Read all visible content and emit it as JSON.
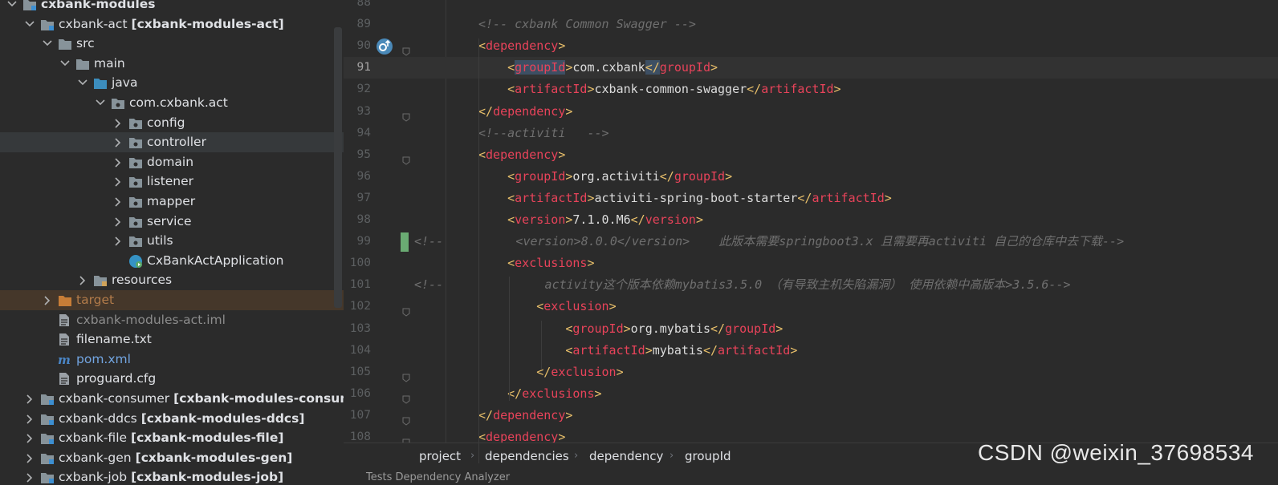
{
  "project_tree": {
    "root": {
      "label": "cxbank-modules"
    },
    "act_module": {
      "label": "cxbank-act",
      "module": "[cxbank-modules-act]"
    },
    "src": {
      "label": "src"
    },
    "main": {
      "label": "main"
    },
    "java": {
      "label": "java"
    },
    "package": {
      "label": "com.cxbank.act"
    },
    "packages": [
      "config",
      "controller",
      "domain",
      "listener",
      "mapper",
      "service",
      "utils"
    ],
    "app_class": {
      "label": "CxBankActApplication"
    },
    "resources": {
      "label": "resources"
    },
    "target": {
      "label": "target"
    },
    "files": [
      "cxbank-modules-act.iml",
      "filename.txt",
      "pom.xml",
      "proguard.cfg"
    ],
    "modules": [
      {
        "label": "cxbank-consumer",
        "module": "[cxbank-modules-consume"
      },
      {
        "label": "cxbank-ddcs",
        "module": "[cxbank-modules-ddcs]"
      },
      {
        "label": "cxbank-file",
        "module": "[cxbank-modules-file]"
      },
      {
        "label": "cxbank-gen",
        "module": "[cxbank-modules-gen]"
      },
      {
        "label": "cxbank-job",
        "module": "[cxbank-modules-job]"
      }
    ]
  },
  "editor": {
    "lines": [
      {
        "n": "88",
        "parts": []
      },
      {
        "n": "89",
        "parts": [
          {
            "t": "<!-- cxbank Common Swagger -->",
            "c": "cmt"
          }
        ]
      },
      {
        "n": "90",
        "parts": [
          {
            "t": "<",
            "c": "tag"
          },
          {
            "t": "dependency",
            "c": "tname"
          },
          {
            "t": ">",
            "c": "tag"
          }
        ]
      },
      {
        "n": "91",
        "parts": [
          {
            "t": "    <",
            "c": "tag"
          },
          {
            "t": "groupId",
            "c": "tname"
          },
          {
            "t": ">",
            "c": "tag"
          },
          {
            "t": "com.cxbank",
            "c": "text"
          },
          {
            "t": "</",
            "c": "tag"
          },
          {
            "t": "groupId",
            "c": "tname"
          },
          {
            "t": ">",
            "c": "tag"
          }
        ]
      },
      {
        "n": "92",
        "parts": [
          {
            "t": "    <",
            "c": "tag"
          },
          {
            "t": "artifactId",
            "c": "tname"
          },
          {
            "t": ">",
            "c": "tag"
          },
          {
            "t": "cxbank-common-swagger",
            "c": "text"
          },
          {
            "t": "</",
            "c": "tag"
          },
          {
            "t": "artifactId",
            "c": "tname"
          },
          {
            "t": ">",
            "c": "tag"
          }
        ]
      },
      {
        "n": "93",
        "parts": [
          {
            "t": "</",
            "c": "tag"
          },
          {
            "t": "dependency",
            "c": "tname"
          },
          {
            "t": ">",
            "c": "tag"
          }
        ]
      },
      {
        "n": "94",
        "parts": [
          {
            "t": "<!--activiti   -->",
            "c": "cmt"
          }
        ]
      },
      {
        "n": "95",
        "parts": [
          {
            "t": "<",
            "c": "tag"
          },
          {
            "t": "dependency",
            "c": "tname"
          },
          {
            "t": ">",
            "c": "tag"
          }
        ]
      },
      {
        "n": "96",
        "parts": [
          {
            "t": "    <",
            "c": "tag"
          },
          {
            "t": "groupId",
            "c": "tname"
          },
          {
            "t": ">",
            "c": "tag"
          },
          {
            "t": "org.activiti",
            "c": "text"
          },
          {
            "t": "</",
            "c": "tag"
          },
          {
            "t": "groupId",
            "c": "tname"
          },
          {
            "t": ">",
            "c": "tag"
          }
        ]
      },
      {
        "n": "97",
        "parts": [
          {
            "t": "    <",
            "c": "tag"
          },
          {
            "t": "artifactId",
            "c": "tname"
          },
          {
            "t": ">",
            "c": "tag"
          },
          {
            "t": "activiti-spring-boot-starter",
            "c": "text"
          },
          {
            "t": "</",
            "c": "tag"
          },
          {
            "t": "artifactId",
            "c": "tname"
          },
          {
            "t": ">",
            "c": "tag"
          }
        ]
      },
      {
        "n": "98",
        "parts": [
          {
            "t": "    <",
            "c": "tag"
          },
          {
            "t": "version",
            "c": "tname"
          },
          {
            "t": ">",
            "c": "tag"
          },
          {
            "t": "7.1.0.M6",
            "c": "text"
          },
          {
            "t": "</",
            "c": "tag"
          },
          {
            "t": "version",
            "c": "tname"
          },
          {
            "t": ">",
            "c": "tag"
          }
        ]
      },
      {
        "n": "99",
        "parts": [
          {
            "t": "<!--          <version>8.0.0</version>    此版本需要springboot3.x 且需要再activiti 自己的仓库中去下载-->",
            "c": "cmt"
          }
        ]
      },
      {
        "n": "100",
        "parts": [
          {
            "t": "    <",
            "c": "tag"
          },
          {
            "t": "exclusions",
            "c": "tname"
          },
          {
            "t": ">",
            "c": "tag"
          }
        ]
      },
      {
        "n": "101",
        "parts": [
          {
            "t": "<!--              activity这个版本依赖mybatis3.5.0 （有导致主机失陷漏洞） 使用依赖中高版本>3.5.6-->",
            "c": "cmt"
          }
        ]
      },
      {
        "n": "102",
        "parts": [
          {
            "t": "        <",
            "c": "tag"
          },
          {
            "t": "exclusion",
            "c": "tname"
          },
          {
            "t": ">",
            "c": "tag"
          }
        ]
      },
      {
        "n": "103",
        "parts": [
          {
            "t": "            <",
            "c": "tag"
          },
          {
            "t": "groupId",
            "c": "tname"
          },
          {
            "t": ">",
            "c": "tag"
          },
          {
            "t": "org.mybatis",
            "c": "text"
          },
          {
            "t": "</",
            "c": "tag"
          },
          {
            "t": "groupId",
            "c": "tname"
          },
          {
            "t": ">",
            "c": "tag"
          }
        ]
      },
      {
        "n": "104",
        "parts": [
          {
            "t": "            <",
            "c": "tag"
          },
          {
            "t": "artifactId",
            "c": "tname"
          },
          {
            "t": ">",
            "c": "tag"
          },
          {
            "t": "mybatis",
            "c": "text"
          },
          {
            "t": "</",
            "c": "tag"
          },
          {
            "t": "artifactId",
            "c": "tname"
          },
          {
            "t": ">",
            "c": "tag"
          }
        ]
      },
      {
        "n": "105",
        "parts": [
          {
            "t": "        </",
            "c": "tag"
          },
          {
            "t": "exclusion",
            "c": "tname"
          },
          {
            "t": ">",
            "c": "tag"
          }
        ]
      },
      {
        "n": "106",
        "parts": [
          {
            "t": "    </",
            "c": "tag"
          },
          {
            "t": "exclusions",
            "c": "tname"
          },
          {
            "t": ">",
            "c": "tag"
          }
        ]
      },
      {
        "n": "107",
        "parts": [
          {
            "t": "</",
            "c": "tag"
          },
          {
            "t": "dependency",
            "c": "tname"
          },
          {
            "t": ">",
            "c": "tag"
          }
        ]
      },
      {
        "n": "108",
        "parts": [
          {
            "t": "<",
            "c": "tag"
          },
          {
            "t": "dependency",
            "c": "tname"
          },
          {
            "t": ">",
            "c": "tag"
          }
        ]
      }
    ]
  },
  "breadcrumb": [
    "project",
    "dependencies",
    "dependency",
    "groupId"
  ],
  "bottom_tabs": "Tests    Dependency    Analyzer",
  "watermark": "CSDN @weixin_37698534",
  "colors": {
    "tag_name": "#e8435a",
    "comment": "#6f6f6f",
    "background": "#2b2b2b",
    "change_marker": "#6aab73"
  }
}
